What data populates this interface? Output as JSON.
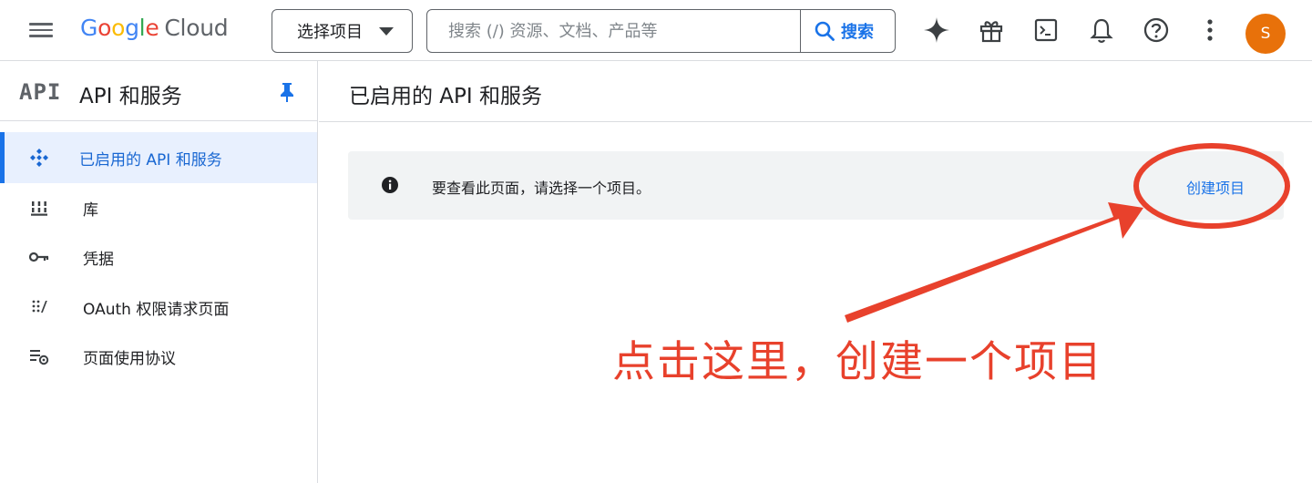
{
  "header": {
    "logo": {
      "G": "G",
      "o1": "o",
      "o2": "o",
      "g": "g",
      "l": "l",
      "e": "e",
      "cloud": "Cloud"
    },
    "project_picker_label": "选择项目",
    "search_placeholder": "搜索 (/) 资源、文档、产品等",
    "search_button_label": "搜索",
    "avatar_letter": "S",
    "icons": [
      "menu-icon",
      "sparkle-icon",
      "gift-icon",
      "terminal-icon",
      "bell-icon",
      "help-icon",
      "more-vert-icon"
    ]
  },
  "sidebar": {
    "logo_text": "API",
    "title": "API 和服务",
    "items": [
      {
        "label": "已启用的 API 和服务",
        "icon": "api-diamond-icon",
        "active": true
      },
      {
        "label": "库",
        "icon": "library-icon",
        "active": false
      },
      {
        "label": "凭据",
        "icon": "key-icon",
        "active": false
      },
      {
        "label": "OAuth 权限请求页面",
        "icon": "oauth-dots-icon",
        "active": false
      },
      {
        "label": "页面使用协议",
        "icon": "settings-list-icon",
        "active": false
      }
    ]
  },
  "main": {
    "title": "已启用的 API 和服务",
    "banner_message": "要查看此页面，请选择一个项目。",
    "create_project_link": "创建项目"
  },
  "annotation": {
    "text": "点击这里，创建一个项目",
    "color": "#e8412c"
  },
  "colors": {
    "accent": "#1a73e8",
    "active_bg": "#e8f0fe",
    "avatar_bg": "#e8710a",
    "banner_bg": "#f1f3f4",
    "annotation": "#e8412c"
  }
}
